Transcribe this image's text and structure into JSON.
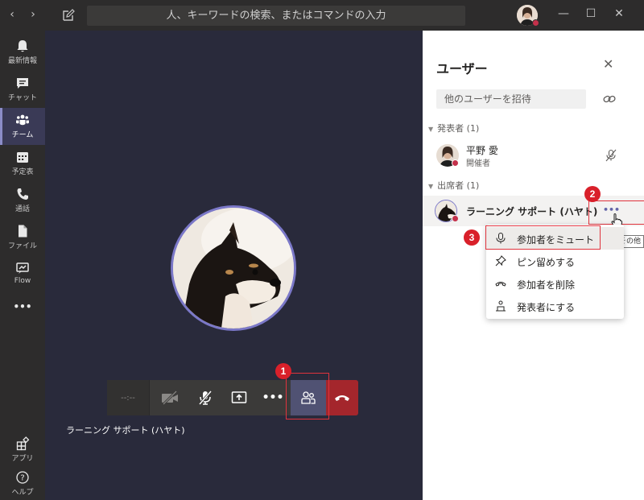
{
  "titlebar": {
    "back": "‹",
    "forward": "›",
    "search_placeholder": "人、キーワードの検索、またはコマンドの入力",
    "minimize": "—",
    "maximize": "☐",
    "close": "✕"
  },
  "rail": {
    "items": [
      {
        "label": "最新情報",
        "icon": "bell-icon"
      },
      {
        "label": "チャット",
        "icon": "chat-icon"
      },
      {
        "label": "チーム",
        "icon": "teams-icon"
      },
      {
        "label": "予定表",
        "icon": "calendar-icon"
      },
      {
        "label": "通話",
        "icon": "phone-icon"
      },
      {
        "label": "ファイル",
        "icon": "file-icon"
      },
      {
        "label": "Flow",
        "icon": "flow-icon"
      },
      {
        "label": "•••",
        "icon": "more-icon"
      }
    ],
    "bottom": [
      {
        "label": "アプリ",
        "icon": "apps-icon"
      },
      {
        "label": "ヘルプ",
        "icon": "help-icon"
      }
    ]
  },
  "stage": {
    "timer": "--:--",
    "more": "•••",
    "participant_name": "ラーニング サポート (ハヤト)"
  },
  "panel": {
    "title": "ユーザー",
    "close": "✕",
    "invite_placeholder": "他のユーザーを招待",
    "presenters_section": "発表者 (1)",
    "presenter": {
      "name": "平野 愛",
      "role": "開催者"
    },
    "attendees_section": "出席者 (1)",
    "attendee": {
      "name": "ラーニング サポート (ハヤト)",
      "more": "•••"
    }
  },
  "context_menu": {
    "items": [
      {
        "label": "参加者をミュート",
        "icon": "mic-icon"
      },
      {
        "label": "ピン留めする",
        "icon": "pin-icon"
      },
      {
        "label": "参加者を削除",
        "icon": "hangup-icon"
      },
      {
        "label": "発表者にする",
        "icon": "presenter-icon"
      }
    ]
  },
  "annotations": {
    "badge1": "1",
    "badge2": "2",
    "badge3": "3"
  },
  "tooltip": "その他",
  "colors": {
    "accent": "#6264a7",
    "annotation_red": "#e0333d",
    "hangup": "#a4262c"
  }
}
